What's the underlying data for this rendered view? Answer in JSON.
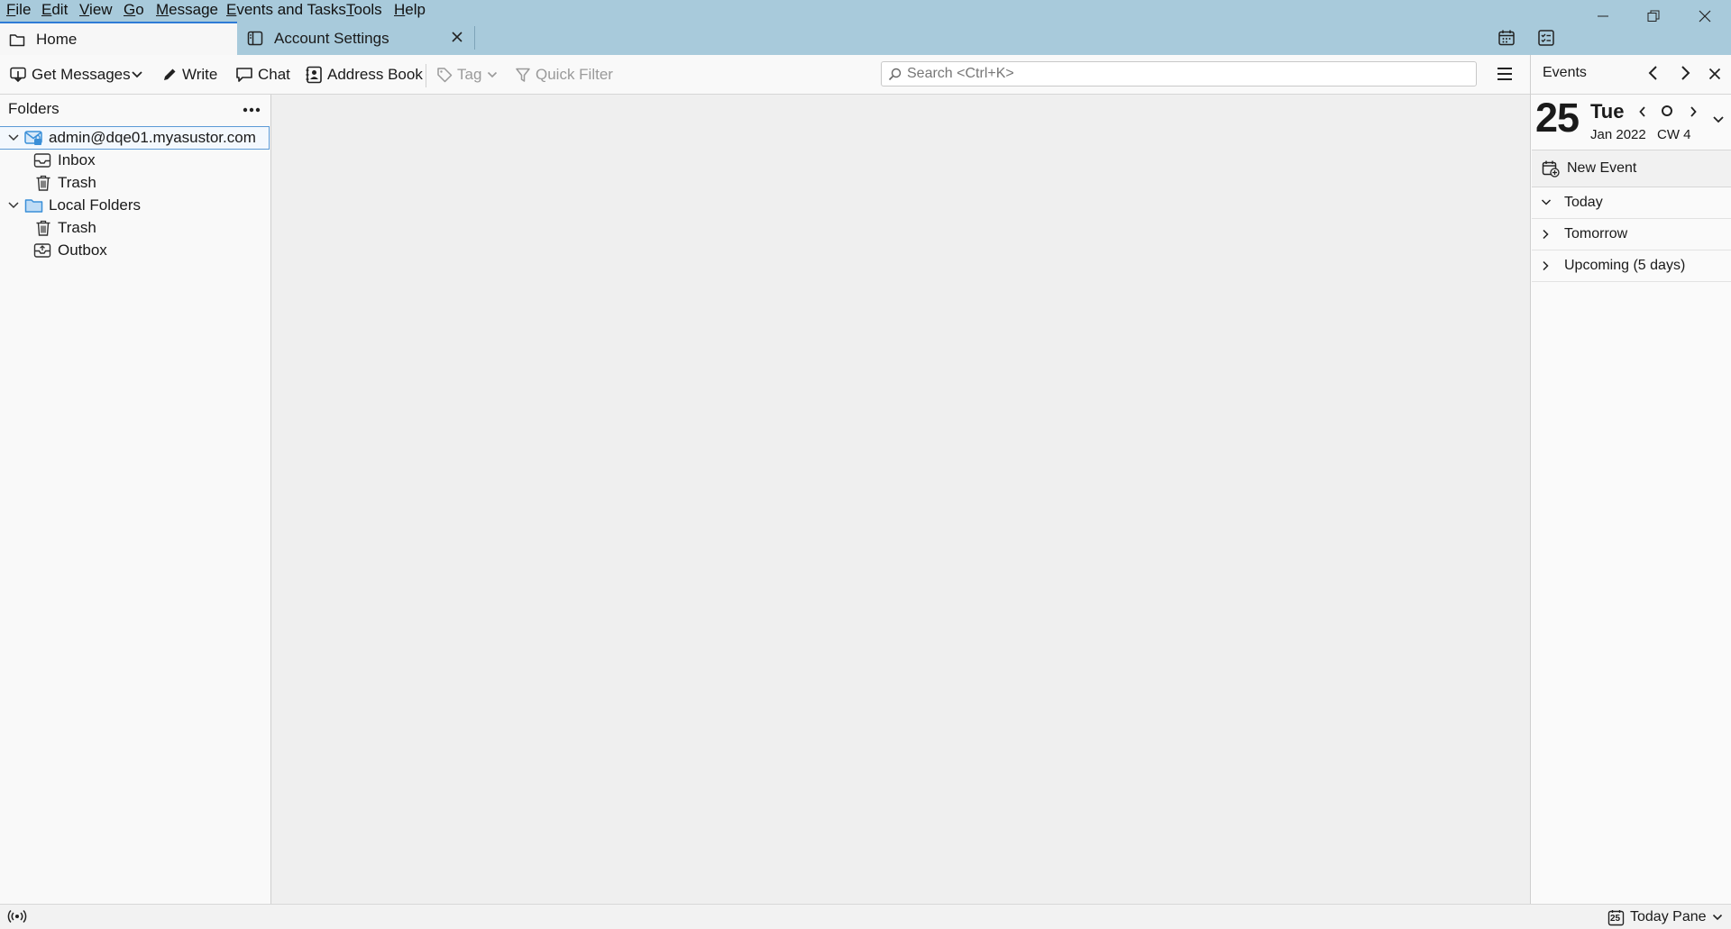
{
  "menu": [
    "File",
    "Edit",
    "View",
    "Go",
    "Message",
    "Events and Tasks",
    "Tools",
    "Help"
  ],
  "tabs": [
    {
      "label": "Home",
      "icon": "folder-icon",
      "active": true
    },
    {
      "label": "Account Settings",
      "icon": "account-settings-icon",
      "active": false
    }
  ],
  "toolbar": {
    "get_messages": "Get Messages",
    "write": "Write",
    "chat": "Chat",
    "address_book": "Address Book",
    "tag": "Tag",
    "quick_filter": "Quick Filter",
    "search_placeholder": "Search <Ctrl+K>"
  },
  "folder_pane": {
    "title": "Folders",
    "accounts": [
      {
        "name": "admin@dqe01.myasustor.com",
        "folders": [
          "Inbox",
          "Trash"
        ]
      },
      {
        "name": "Local Folders",
        "folders": [
          "Trash",
          "Outbox"
        ]
      }
    ]
  },
  "today_pane": {
    "title": "Events",
    "day_number": "25",
    "weekday": "Tue",
    "month_year": "Jan 2022",
    "calendar_week": "CW 4",
    "new_event": "New Event",
    "sections": [
      "Today",
      "Tomorrow",
      "Upcoming (5 days)"
    ]
  },
  "statusbar": {
    "today_pane_label": "Today Pane",
    "today_pane_icon_day": "25"
  },
  "colors": {
    "titlebar": "#a8cadb",
    "accent": "#2e7bd6",
    "folder_blue": "#3a8fd8"
  }
}
